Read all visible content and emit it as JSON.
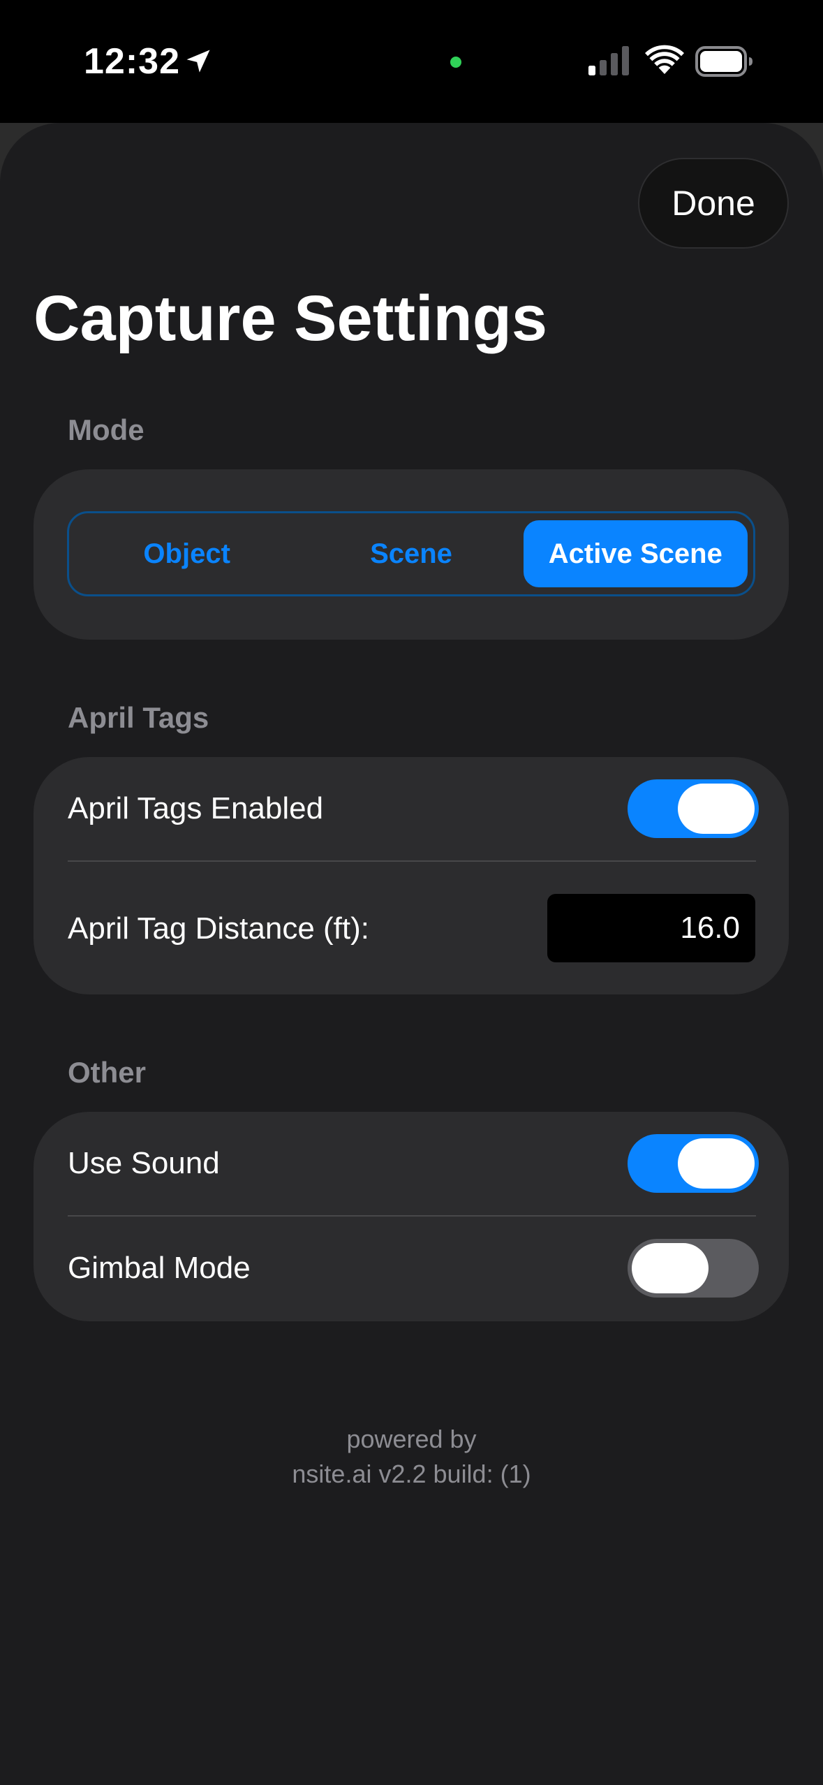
{
  "status_bar": {
    "time": "12:32",
    "icons": [
      "location-arrow-icon",
      "camera-indicator-dot",
      "cellular-signal-icon",
      "wifi-icon",
      "battery-icon"
    ],
    "indicator_color": "#30d158"
  },
  "header": {
    "done_label": "Done",
    "title": "Capture Settings"
  },
  "mode": {
    "header": "Mode",
    "segments": [
      "Object",
      "Scene",
      "Active Scene"
    ],
    "selected": "Active Scene"
  },
  "april_tags": {
    "header": "April Tags",
    "enabled_label": "April Tags Enabled",
    "enabled": true,
    "distance_label": "April Tag Distance (ft):",
    "distance_value": "16.0"
  },
  "other": {
    "header": "Other",
    "use_sound_label": "Use Sound",
    "use_sound": true,
    "gimbal_mode_label": "Gimbal Mode",
    "gimbal_mode": false
  },
  "footer": {
    "line1": "powered by",
    "line2": "nsite.ai v2.2 build: (1)"
  },
  "colors": {
    "accent": "#0a84ff",
    "background": "#1c1c1e",
    "group_background": "#2c2c2e",
    "secondary_text": "#8d8d93"
  }
}
